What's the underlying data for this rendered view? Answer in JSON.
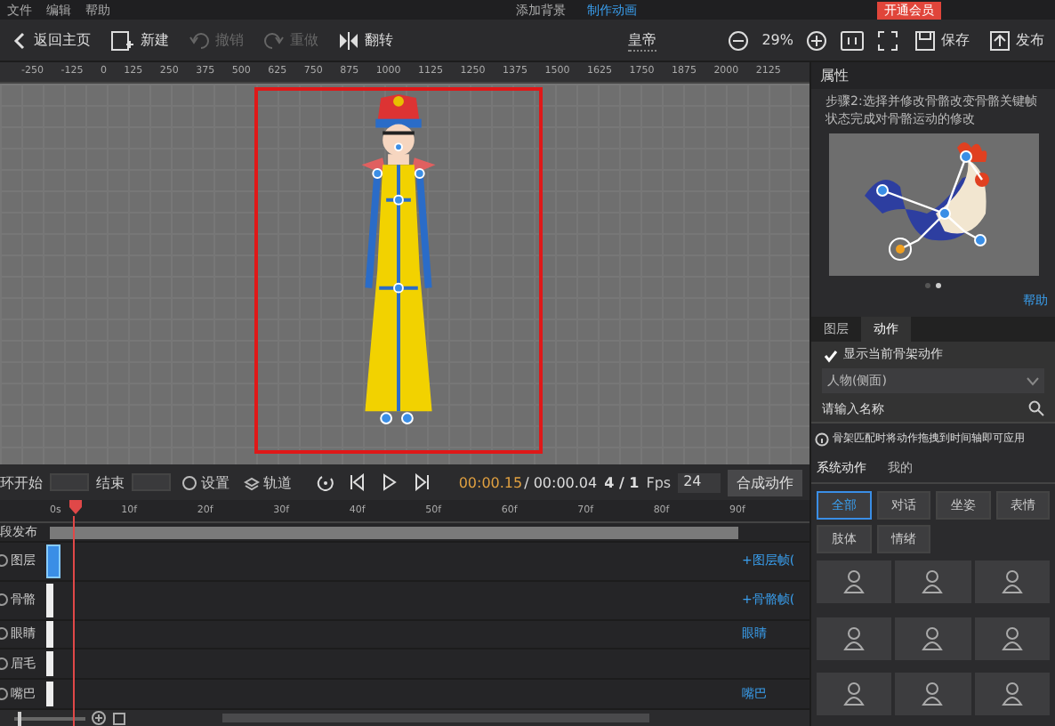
{
  "menu": [
    "文件",
    "编辑",
    "帮助"
  ],
  "steps": [
    {
      "label": "添加背景",
      "selected": false
    },
    {
      "label": "制作动画",
      "selected": true
    }
  ],
  "vip_badge": "开通会员",
  "toolbar": {
    "left": [
      {
        "kind": "home",
        "label": "返回主页",
        "disabled": false
      },
      {
        "kind": "new",
        "label": "新建",
        "disabled": false
      },
      {
        "kind": "undo",
        "label": "撤销",
        "disabled": true
      },
      {
        "kind": "redo",
        "label": "重做",
        "disabled": true
      },
      {
        "kind": "flip",
        "label": "翻转",
        "disabled": false
      }
    ],
    "title": "皇帝",
    "zoom": "29%",
    "right": [
      {
        "kind": "save",
        "label": "保存"
      },
      {
        "kind": "publish",
        "label": "发布"
      }
    ]
  },
  "ruler": [
    "-250",
    "-125",
    "0",
    "125",
    "250",
    "375",
    "500",
    "625",
    "750",
    "875",
    "1000",
    "1125",
    "1250",
    "1375",
    "1500",
    "1625",
    "1750",
    "1875",
    "2000",
    "2125"
  ],
  "timeline": {
    "loop_start_label": "环开始",
    "end_label": "结束",
    "settings": "设置",
    "tracks_button": "轨道",
    "current_time": "00:00.15",
    "total_time": "/ 00:00.04",
    "frames": "4 / 1",
    "fps_label": "Fps",
    "fps": "24",
    "compose_button": "合成动作",
    "ticks": [
      "0s",
      "10f",
      "20f",
      "30f",
      "40f",
      "50f",
      "60f",
      "70f",
      "80f",
      "90f"
    ],
    "publish_row": "段发布",
    "zoom_slider": {
      "level": 0.05
    },
    "tracks": [
      {
        "name": "图层",
        "action": "+图层帧("
      },
      {
        "name": "骨骼",
        "action": "+骨骼帧("
      },
      {
        "name": "眼睛",
        "action": "眼睛"
      },
      {
        "name": "眉毛"
      },
      {
        "name": "嘴巴",
        "action": "嘴巴"
      }
    ]
  },
  "panel": {
    "title": "属性",
    "step_text": "步骤2:选择并修改骨骼改变骨骼关键帧状态完成对骨骼运动的修改",
    "pages": [
      {
        "selected": false
      },
      {
        "selected": true
      }
    ],
    "help": "帮助",
    "tabs": [
      {
        "label": "图层",
        "selected": false
      },
      {
        "label": "动作",
        "selected": true
      }
    ],
    "show_current": {
      "label": "显示当前骨架动作",
      "checked": true
    },
    "skeleton_select": "人物(侧面)",
    "search_placeholder": "请输入名称",
    "info": "骨架匹配时将动作拖拽到时间轴即可应用",
    "action_tabs": [
      {
        "label": "系统动作",
        "selected": true
      },
      {
        "label": "我的",
        "selected": false
      }
    ],
    "filters": [
      {
        "label": "全部",
        "selected": true
      },
      {
        "label": "对话",
        "selected": false
      },
      {
        "label": "坐姿",
        "selected": false
      },
      {
        "label": "表情",
        "selected": false
      },
      {
        "label": "肢体",
        "selected": false
      },
      {
        "label": "情绪",
        "selected": false
      }
    ]
  }
}
